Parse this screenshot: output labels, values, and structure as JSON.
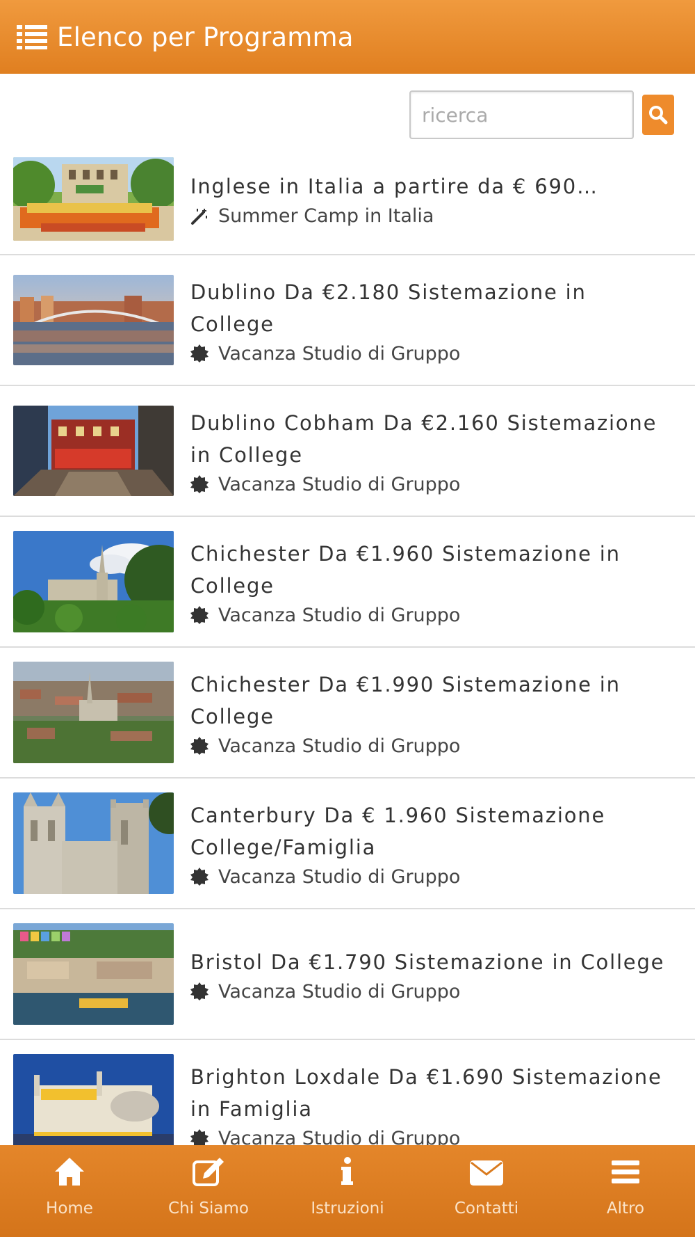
{
  "header": {
    "title": "Elenco per Programma"
  },
  "search": {
    "placeholder": "ricerca",
    "value": ""
  },
  "items": [
    {
      "title": "Inglese in Italia a partire da € 690…",
      "category": "Summer Camp in Italia",
      "category_icon": "magic-wand-icon"
    },
    {
      "title": "Dublino Da €2.180 Sistemazione in College",
      "category": "Vacanza Studio di Gruppo",
      "category_icon": "badge-icon"
    },
    {
      "title": "Dublino Cobham Da €2.160 Sistemazione in College",
      "category": "Vacanza Studio di Gruppo",
      "category_icon": "badge-icon"
    },
    {
      "title": "Chichester Da €1.960 Sistemazione in College",
      "category": "Vacanza Studio di Gruppo",
      "category_icon": "badge-icon"
    },
    {
      "title": "Chichester Da €1.990 Sistemazione in College",
      "category": "Vacanza Studio di Gruppo",
      "category_icon": "badge-icon"
    },
    {
      "title": "Canterbury Da € 1.960 Sistemazione College/Famiglia",
      "category": "Vacanza Studio di Gruppo",
      "category_icon": "badge-icon"
    },
    {
      "title": "Bristol Da €1.790 Sistemazione in College",
      "category": "Vacanza Studio di Gruppo",
      "category_icon": "badge-icon"
    },
    {
      "title": "Brighton Loxdale Da €1.690 Sistemazione in Famiglia",
      "category": "Vacanza Studio di Gruppo",
      "category_icon": "badge-icon"
    }
  ],
  "footer": {
    "tabs": [
      {
        "label": "Home",
        "icon": "home-icon"
      },
      {
        "label": "Chi Siamo",
        "icon": "edit-icon"
      },
      {
        "label": "Istruzioni",
        "icon": "info-icon"
      },
      {
        "label": "Contatti",
        "icon": "envelope-icon"
      },
      {
        "label": "Altro",
        "icon": "menu-icon"
      }
    ]
  },
  "colors": {
    "accent": "#ee8b2c",
    "header": "#e8892c",
    "footer": "#d97a1e"
  }
}
